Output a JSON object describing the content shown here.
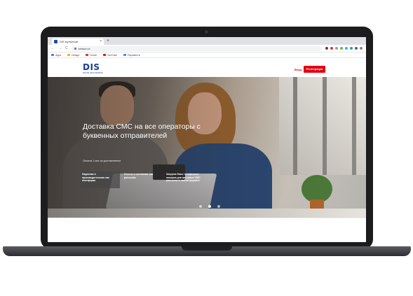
{
  "browser": {
    "tab_title": "DIS мультичат",
    "tab_close": "×",
    "new_tab": "+",
    "url": "smsuz.uz",
    "nav": {
      "back": "←",
      "forward": "→",
      "reload": "C"
    },
    "bookmarks": [
      {
        "label": "Apps",
        "color": "#4a7bd9"
      },
      {
        "label": "Design",
        "color": "#f0b400"
      },
      {
        "label": "Gmail",
        "color": "#d93025"
      },
      {
        "label": "YouTube",
        "color": "#ff0000"
      },
      {
        "label": "Перевести",
        "color": "#4285f4"
      }
    ],
    "extensions": [
      "#4a4a4a",
      "#e53935",
      "#9e9e9e",
      "#7cb342",
      "#29b6f6",
      "#26a69a",
      "#616161",
      "#888888"
    ]
  },
  "site": {
    "logo": "DIS",
    "logo_subtitle": "DIGITAL INFO SERVICE",
    "login": "Вход",
    "register": "Регистрация",
    "brand_color": "#e30613"
  },
  "hero": {
    "title": "Доставка СМС на все операторы с буквенных отправителей",
    "subtitle": "Оплата 1 смс за доставленное",
    "features": [
      "Надежная и производительная смс платформа",
      "Отчеты о состоянии смс рассылки",
      "Загрузка базы телефонных номеров для массовых СМС рассылок в любом формате"
    ],
    "slides_total": 3,
    "active_slide": 1
  }
}
